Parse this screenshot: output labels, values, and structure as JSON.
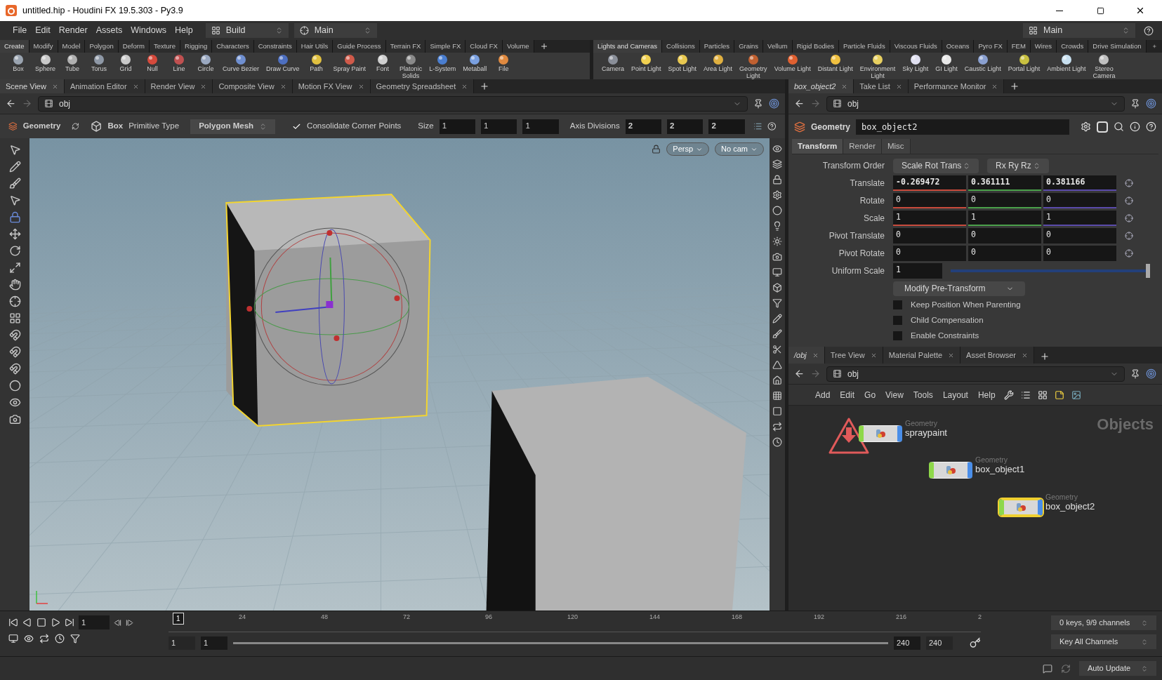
{
  "window": {
    "title": "untitled.hip - Houdini FX 19.5.303 - Py3.9"
  },
  "menu": [
    "File",
    "Edit",
    "Render",
    "Assets",
    "Windows",
    "Help"
  ],
  "desktop": "Build",
  "context": "Main",
  "desktop_right": "Main",
  "shelf_left": {
    "tabs": [
      {
        "label": "Create",
        "selected": true
      },
      {
        "label": "Modify",
        "selected": false
      },
      {
        "label": "Model",
        "selected": false
      },
      {
        "label": "Polygon",
        "selected": false
      },
      {
        "label": "Deform",
        "selected": false
      },
      {
        "label": "Texture",
        "selected": false
      },
      {
        "label": "Rigging",
        "selected": false
      },
      {
        "label": "Characters",
        "selected": false
      },
      {
        "label": "Constraints",
        "selected": false
      },
      {
        "label": "Hair Utils",
        "selected": false
      },
      {
        "label": "Guide Process",
        "selected": false
      },
      {
        "label": "Terrain FX",
        "selected": false
      },
      {
        "label": "Simple FX",
        "selected": false
      },
      {
        "label": "Cloud FX",
        "selected": false
      },
      {
        "label": "Volume",
        "selected": false
      }
    ],
    "tools": [
      "Box",
      "Sphere",
      "Tube",
      "Torus",
      "Grid",
      "Null",
      "Line",
      "Circle",
      "Curve Bezier",
      "Draw Curve",
      "Path",
      "Spray Paint",
      "Font",
      "Platonic\nSolids",
      "L-System",
      "Metaball",
      "File"
    ]
  },
  "shelf_right": {
    "tabs": [
      {
        "label": "Lights and Cameras",
        "selected": true
      },
      {
        "label": "Collisions",
        "selected": false
      },
      {
        "label": "Particles",
        "selected": false
      },
      {
        "label": "Grains",
        "selected": false
      },
      {
        "label": "Vellum",
        "selected": false
      },
      {
        "label": "Rigid Bodies",
        "selected": false
      },
      {
        "label": "Particle Fluids",
        "selected": false
      },
      {
        "label": "Viscous Fluids",
        "selected": false
      },
      {
        "label": "Oceans",
        "selected": false
      },
      {
        "label": "Pyro FX",
        "selected": false
      },
      {
        "label": "FEM",
        "selected": false
      },
      {
        "label": "Wires",
        "selected": false
      },
      {
        "label": "Crowds",
        "selected": false
      },
      {
        "label": "Drive Simulation",
        "selected": false
      }
    ],
    "tools": [
      "Camera",
      "Point Light",
      "Spot Light",
      "Area Light",
      "Geometry\nLight",
      "Volume Light",
      "Distant Light",
      "Environment\nLight",
      "Sky Light",
      "GI Light",
      "Caustic Light",
      "Portal Light",
      "Ambient Light",
      "Stereo\nCamera"
    ]
  },
  "scene_tabs": [
    {
      "label": "Scene View",
      "selected": true
    },
    {
      "label": "Animation Editor",
      "selected": false
    },
    {
      "label": "Render View",
      "selected": false
    },
    {
      "label": "Composite View",
      "selected": false
    },
    {
      "label": "Motion FX View",
      "selected": false
    },
    {
      "label": "Geometry Spreadsheet",
      "selected": false
    }
  ],
  "scene_path": "obj",
  "tool_options": {
    "node_type": "Geometry",
    "shape": "Box",
    "primitive_label": "Primitive Type",
    "primitive_value": "Polygon Mesh",
    "consolidate": {
      "label": "Consolidate Corner Points",
      "checked": true
    },
    "size_label": "Size",
    "size": [
      "1",
      "1",
      "1"
    ],
    "divisions_label": "Axis Divisions",
    "divisions": [
      "2",
      "2",
      "2"
    ]
  },
  "viewport": {
    "camera": "Persp",
    "view": "No cam"
  },
  "param_tabs": [
    {
      "label": "box_object2",
      "selected": true
    },
    {
      "label": "Take List",
      "selected": false
    },
    {
      "label": "Performance Monitor",
      "selected": false
    }
  ],
  "param_path": "obj",
  "node": {
    "type": "Geometry",
    "name": "box_object2"
  },
  "param_sections": [
    {
      "label": "Transform",
      "selected": true
    },
    {
      "label": "Render",
      "selected": false
    },
    {
      "label": "Misc",
      "selected": false
    }
  ],
  "params": [
    {
      "kind": "menus",
      "label": "Transform Order",
      "values": [
        "Scale Rot Trans",
        "Rx Ry Rz"
      ]
    },
    {
      "kind": "vector",
      "label": "Translate",
      "values": [
        "-0.269472",
        "0.361111",
        "0.381166"
      ],
      "colored": true,
      "bold": true
    },
    {
      "kind": "vector",
      "label": "Rotate",
      "values": [
        "0",
        "0",
        "0"
      ],
      "colored": true,
      "bold": false
    },
    {
      "kind": "vector",
      "label": "Scale",
      "values": [
        "1",
        "1",
        "1"
      ],
      "colored": true,
      "bold": false
    },
    {
      "kind": "vector",
      "label": "Pivot Translate",
      "values": [
        "0",
        "0",
        "0"
      ],
      "colored": false,
      "bold": false
    },
    {
      "kind": "vector",
      "label": "Pivot Rotate",
      "values": [
        "0",
        "0",
        "0"
      ],
      "colored": false,
      "bold": false
    },
    {
      "kind": "slider",
      "label": "Uniform Scale",
      "value": "1",
      "level": 1.0
    },
    {
      "kind": "menu",
      "value": "Modify Pre-Transform"
    },
    {
      "kind": "checkbox",
      "label": "Keep Position When Parenting",
      "checked": false
    },
    {
      "kind": "checkbox",
      "label": "Child Compensation",
      "checked": false
    },
    {
      "kind": "checkbox",
      "label": "Enable Constraints",
      "checked": false
    }
  ],
  "network_tabs": [
    {
      "label": "/obj",
      "selected": true
    },
    {
      "label": "Tree View",
      "selected": false
    },
    {
      "label": "Material Palette",
      "selected": false
    },
    {
      "label": "Asset Browser",
      "selected": false
    }
  ],
  "network_path": "obj",
  "network_menu": [
    "Add",
    "Edit",
    "Go",
    "View",
    "Tools",
    "Layout",
    "Help"
  ],
  "network": {
    "context_label": "Objects",
    "nodes": [
      {
        "type": "Geometry",
        "name": "spraypaint",
        "selected": false,
        "warning": true
      },
      {
        "type": "Geometry",
        "name": "box_object1",
        "selected": false,
        "warning": false
      },
      {
        "type": "Geometry",
        "name": "box_object2",
        "selected": true,
        "warning": false
      }
    ]
  },
  "timeline": {
    "cursor": "1",
    "frame": "1",
    "ticks": [
      "24",
      "48",
      "72",
      "96",
      "120",
      "144",
      "168",
      "192",
      "216",
      "2"
    ],
    "start": "1",
    "range_start": "1",
    "range_end": "240",
    "end": "240",
    "keys": "0 keys, 9/9 channels",
    "key_mode": "Key All Channels"
  },
  "status": {
    "update_mode": "Auto Update"
  }
}
